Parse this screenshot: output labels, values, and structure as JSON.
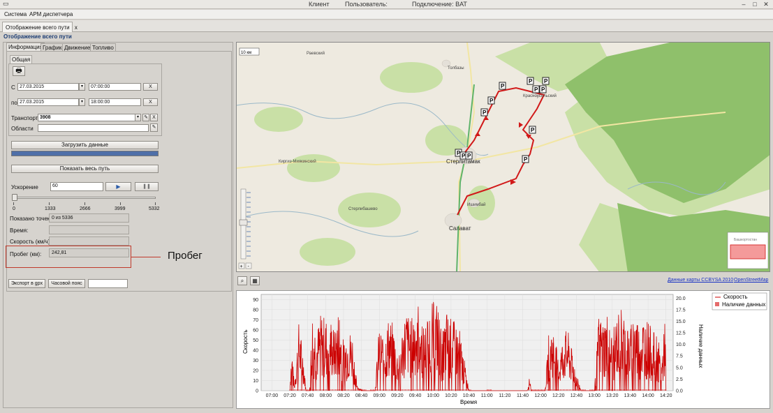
{
  "window": {
    "client_label": "Клиент",
    "user_label": "Пользователь:",
    "connection": "Подключение: BAT"
  },
  "menu": [
    "Система",
    "АРМ диспетчера"
  ],
  "doc_tab": {
    "label": "Отображение всего пути",
    "close": "x"
  },
  "section_title": "Отображение всего пути",
  "tabs": [
    "Информация",
    "График",
    "Движение",
    "Топливо"
  ],
  "subtab": "Общая",
  "filters": {
    "from_label": "С",
    "from_date": "27.03.2015",
    "from_time": "07:00:00",
    "to_label": "по",
    "to_date": "27.03.2015",
    "to_time": "18:00:00",
    "clear": "X",
    "transport_label": "Транспорт",
    "transport_value": "3908",
    "regions_label": "Области",
    "regions_value": ""
  },
  "load_button": "Загрузить данные",
  "progress": 1.0,
  "show_path_button": "Показать весь путь",
  "speedup": {
    "label": "Ускорение",
    "value": "60"
  },
  "slider": {
    "ticks": [
      "0",
      "1333",
      "2666",
      "3999",
      "5332"
    ],
    "value": 0
  },
  "info": {
    "points_label": "Показано точек:",
    "points_value": "0 из 5336",
    "time_label": "Время:",
    "time_value": "",
    "speed_label": "Скорость (км/ч):",
    "speed_value": "",
    "mileage_label": "Пробег (км):",
    "mileage_value": "242,81"
  },
  "annotation": "Пробег",
  "bottom": {
    "export_button": "Экспорт в gpx",
    "timezone_button": "Часовой пояс",
    "timezone_value": ""
  },
  "map": {
    "scale": "10 км",
    "places": [
      "Раевский",
      "Толбазы",
      "Красноусольский",
      "Стерлитамак",
      "Киргиз-Миякинский",
      "Стерлибашево",
      "Ишимбай",
      "Салават",
      "Башкортостан"
    ],
    "attribution_1": "Данные карты CCBYSA 2010",
    "attribution_2": "OpenStreetMap",
    "zoom_plus": "+",
    "zoom_minus": "-"
  },
  "chart_data": {
    "type": "line",
    "xlabel": "Время",
    "ylabel": "Скорость",
    "y2label": "Наличие данных",
    "x_ticks": [
      "07:00",
      "07:20",
      "07:40",
      "08:00",
      "08:20",
      "08:40",
      "09:00",
      "09:20",
      "09:40",
      "10:00",
      "10:20",
      "10:40",
      "11:00",
      "11:20",
      "11:40",
      "12:00",
      "12:20",
      "12:40",
      "13:00",
      "13:20",
      "13:40",
      "14:00",
      "14:20"
    ],
    "y_ticks": [
      "0",
      "10",
      "20",
      "30",
      "40",
      "50",
      "60",
      "70",
      "80",
      "90"
    ],
    "y2_ticks": [
      "0.0",
      "2.5",
      "5.0",
      "7.5",
      "10.0",
      "12.5",
      "15.0",
      "17.5",
      "20.0"
    ],
    "ylim": [
      0,
      95
    ],
    "xlim": [
      "07:00",
      "14:20"
    ],
    "grid": true,
    "legend_position": "top-right",
    "series": [
      {
        "name": "Скорость",
        "color": "#cc0000",
        "envelope": [
          [
            "07:20",
            0
          ],
          [
            "07:22",
            50
          ],
          [
            "07:25",
            5
          ],
          [
            "07:30",
            68
          ],
          [
            "07:35",
            40
          ],
          [
            "07:38",
            0
          ],
          [
            "07:42",
            0
          ],
          [
            "07:45",
            82
          ],
          [
            "07:50",
            60
          ],
          [
            "07:55",
            78
          ],
          [
            "08:00",
            72
          ],
          [
            "08:05",
            75
          ],
          [
            "08:10",
            60
          ],
          [
            "08:15",
            85
          ],
          [
            "08:20",
            50
          ],
          [
            "08:25",
            62
          ],
          [
            "08:30",
            58
          ],
          [
            "08:35",
            5
          ],
          [
            "08:42",
            0
          ],
          [
            "08:55",
            0
          ],
          [
            "09:00",
            68
          ],
          [
            "09:05",
            55
          ],
          [
            "09:10",
            72
          ],
          [
            "09:15",
            68
          ],
          [
            "09:20",
            40
          ],
          [
            "09:25",
            60
          ],
          [
            "09:30",
            82
          ],
          [
            "09:35",
            70
          ],
          [
            "09:40",
            88
          ],
          [
            "09:45",
            90
          ],
          [
            "09:50",
            60
          ],
          [
            "09:55",
            85
          ],
          [
            "10:00",
            88
          ],
          [
            "10:05",
            90
          ],
          [
            "10:10",
            55
          ],
          [
            "10:15",
            80
          ],
          [
            "10:20",
            72
          ],
          [
            "10:25",
            68
          ],
          [
            "10:30",
            60
          ],
          [
            "10:35",
            30
          ],
          [
            "10:40",
            0
          ],
          [
            "11:45",
            0
          ],
          [
            "11:48",
            15
          ],
          [
            "11:50",
            0
          ],
          [
            "12:05",
            0
          ],
          [
            "12:10",
            70
          ],
          [
            "12:15",
            60
          ],
          [
            "12:20",
            30
          ],
          [
            "12:25",
            55
          ],
          [
            "12:30",
            62
          ],
          [
            "12:35",
            40
          ],
          [
            "12:45",
            0
          ],
          [
            "13:00",
            0
          ],
          [
            "13:05",
            75
          ],
          [
            "13:10",
            70
          ],
          [
            "13:15",
            80
          ],
          [
            "13:20",
            55
          ],
          [
            "13:25",
            75
          ],
          [
            "13:30",
            85
          ],
          [
            "13:35",
            78
          ],
          [
            "13:40",
            60
          ],
          [
            "13:45",
            88
          ],
          [
            "13:50",
            65
          ],
          [
            "13:55",
            75
          ],
          [
            "14:00",
            70
          ],
          [
            "14:05",
            58
          ],
          [
            "14:10",
            60
          ],
          [
            "14:15",
            30
          ],
          [
            "14:18",
            60
          ],
          [
            "14:19",
            92
          ],
          [
            "14:20",
            0
          ]
        ]
      },
      {
        "name": "Наличие данных",
        "color": "#e56b6b",
        "segments": [
          [
            "07:20",
            "08:45"
          ],
          [
            "08:50",
            "10:42"
          ],
          [
            "11:00",
            "11:05"
          ],
          [
            "11:50",
            "12:50"
          ],
          [
            "12:55",
            "14:20"
          ]
        ],
        "level": 0.3
      }
    ]
  }
}
